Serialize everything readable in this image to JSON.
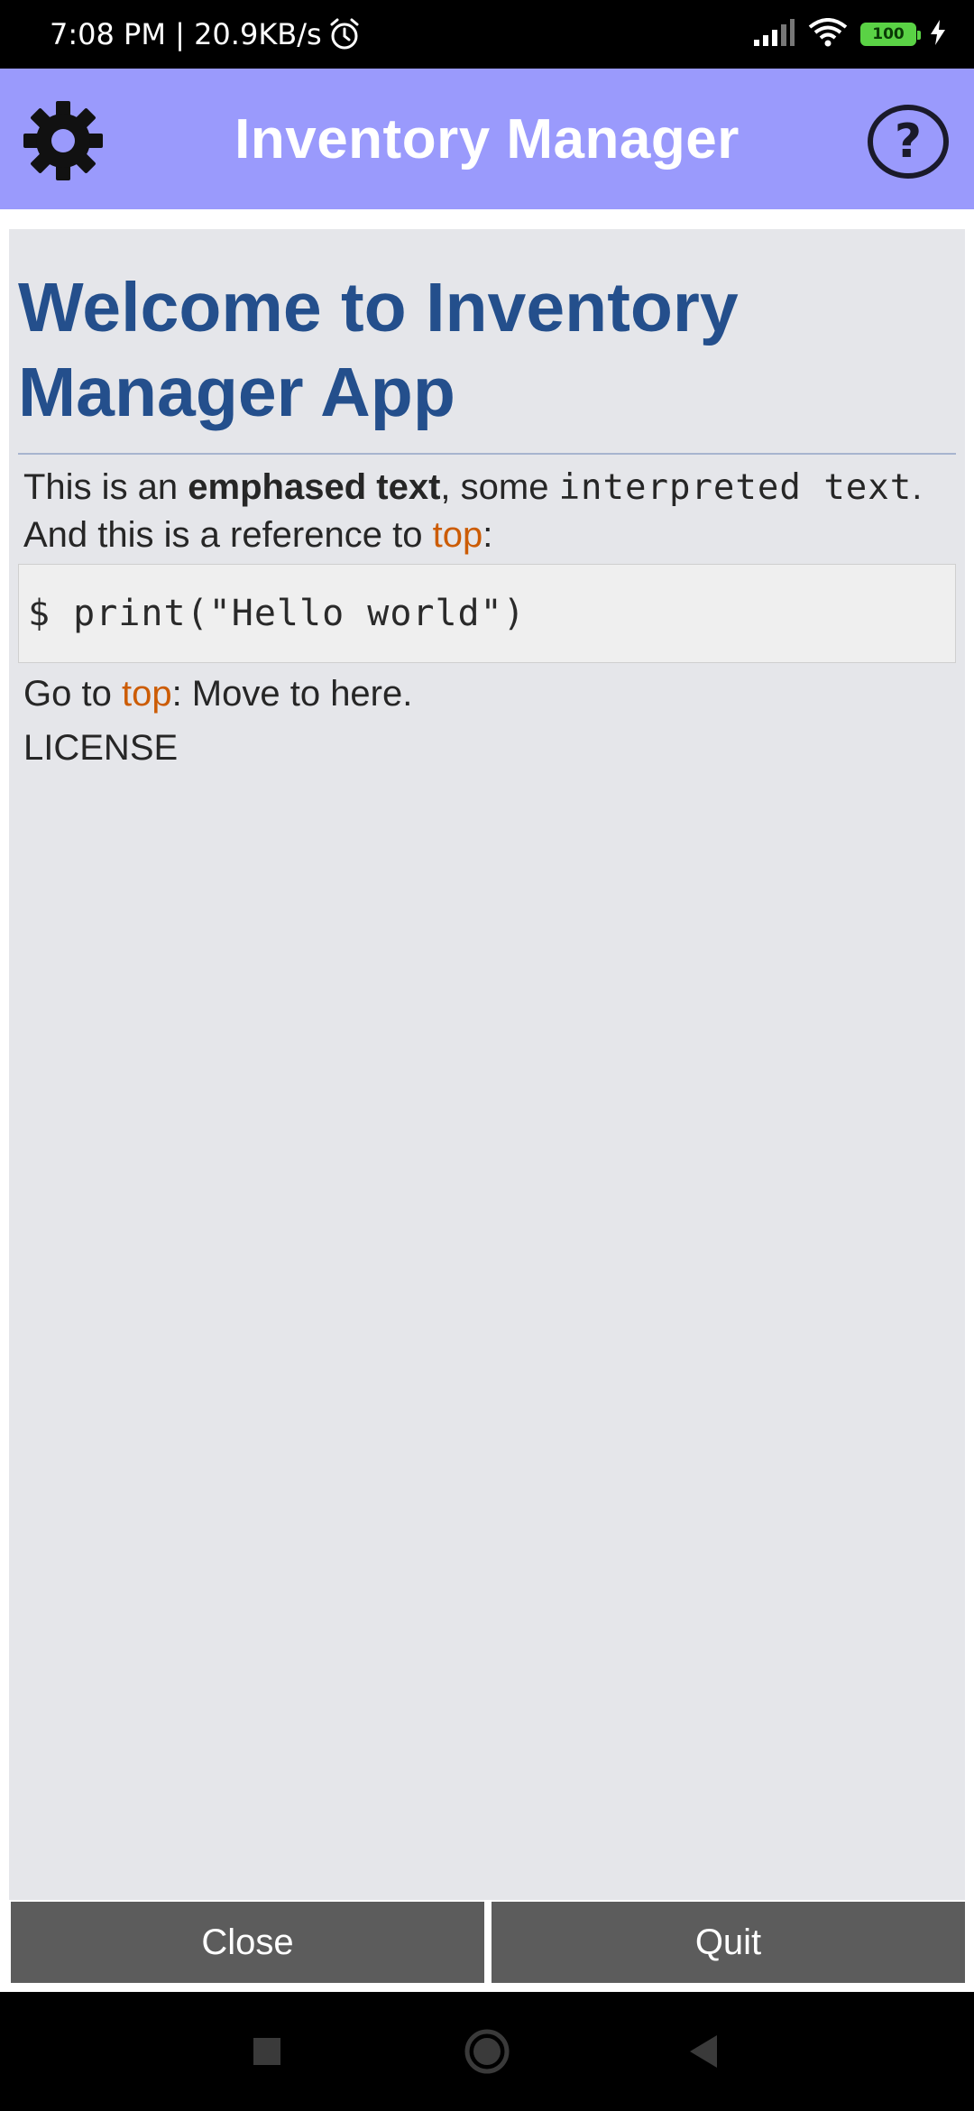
{
  "status_bar": {
    "time_speed": "7:08 PM | 20.9KB/s",
    "battery": "100",
    "icons": [
      "alarm-icon",
      "signal-icon",
      "wifi-icon",
      "battery-icon",
      "charging-icon"
    ]
  },
  "app_bar": {
    "title": "Inventory Manager",
    "settings_icon": "gear-icon",
    "help_icon": "help-icon",
    "background": "#9a9afc"
  },
  "content": {
    "heading": "Welcome to Inventory Manager App",
    "para1_prefix": "This is an ",
    "para1_strong": "emphased text",
    "para1_middle": ", some ",
    "para1_mono": "interpreted text",
    "para1_end": ".",
    "para2_prefix": "And this is a reference to ",
    "para2_link": "top",
    "para2_end": ":",
    "code": "$ print(\"Hello world\")",
    "goto_prefix": "Go to ",
    "goto_link": "top",
    "goto_suffix": ": Move to here.",
    "license": "LICENSE",
    "heading_color": "#244f8c",
    "link_color": "#cc5c05"
  },
  "buttons": {
    "close": "Close",
    "quit": "Quit"
  },
  "nav": {
    "icons": [
      "recents-icon",
      "home-icon",
      "back-icon"
    ]
  }
}
